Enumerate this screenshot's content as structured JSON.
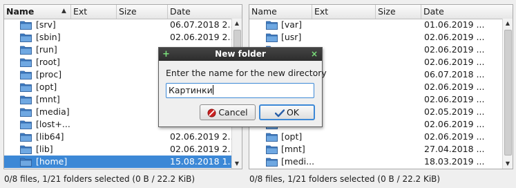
{
  "left_panel": {
    "columns": {
      "name": "Name",
      "ext": "Ext",
      "size": "Size",
      "date": "Date"
    },
    "rows": [
      {
        "name": "[srv]",
        "date": "06.07.2018 2..."
      },
      {
        "name": "[sbin]",
        "date": "02.06.2019 2..."
      },
      {
        "name": "[run]",
        "date": ""
      },
      {
        "name": "[root]",
        "date": ""
      },
      {
        "name": "[proc]",
        "date": ""
      },
      {
        "name": "[opt]",
        "date": ""
      },
      {
        "name": "[mnt]",
        "date": ""
      },
      {
        "name": "[media]",
        "date": ""
      },
      {
        "name": "[lost+...",
        "date": ""
      },
      {
        "name": "[lib64]",
        "date": "02.06.2019 2..."
      },
      {
        "name": "[lib]",
        "date": "02.06.2019 2..."
      },
      {
        "name": "[home]",
        "date": "15.08.2018 1...",
        "selected": true
      }
    ],
    "status": "0/8 files, 1/21 folders selected (0 B / 22.2 KiB)"
  },
  "right_panel": {
    "columns": {
      "name": "Name",
      "ext": "Ext",
      "size": "Size",
      "date": "Date"
    },
    "rows": [
      {
        "name": "[var]",
        "date": "01.06.2019 ..."
      },
      {
        "name": "[usr]",
        "date": "02.06.2019 ..."
      },
      {
        "name": "",
        "date": "02.06.2019 ..."
      },
      {
        "name": "",
        "date": "02.06.2019 ..."
      },
      {
        "name": "",
        "date": "06.07.2018 ..."
      },
      {
        "name": "",
        "date": "02.06.2019 ..."
      },
      {
        "name": "",
        "date": "02.06.2019 ..."
      },
      {
        "name": "",
        "date": "02.05.2019 ..."
      },
      {
        "name": "",
        "date": "02.06.2019 ..."
      },
      {
        "name": "[opt]",
        "date": "02.06.2019 ..."
      },
      {
        "name": "[mnt]",
        "date": "27.04.2018 ..."
      },
      {
        "name": "[medi...",
        "date": "18.03.2019 ..."
      }
    ],
    "status": "0/8 files, 1/21 folders selected (0 B / 22.2 KiB)"
  },
  "dialog": {
    "title": "New folder",
    "prompt": "Enter the name for the new directory",
    "value": "Картинки",
    "cancel_label": "Cancel",
    "ok_label": "OK"
  },
  "colors": {
    "selection": "#3c88d6",
    "folder": "#4d90d8",
    "title_bar": "#333333",
    "cancel_icon": "#cc2222",
    "ok_icon": "#2a5fa8"
  }
}
